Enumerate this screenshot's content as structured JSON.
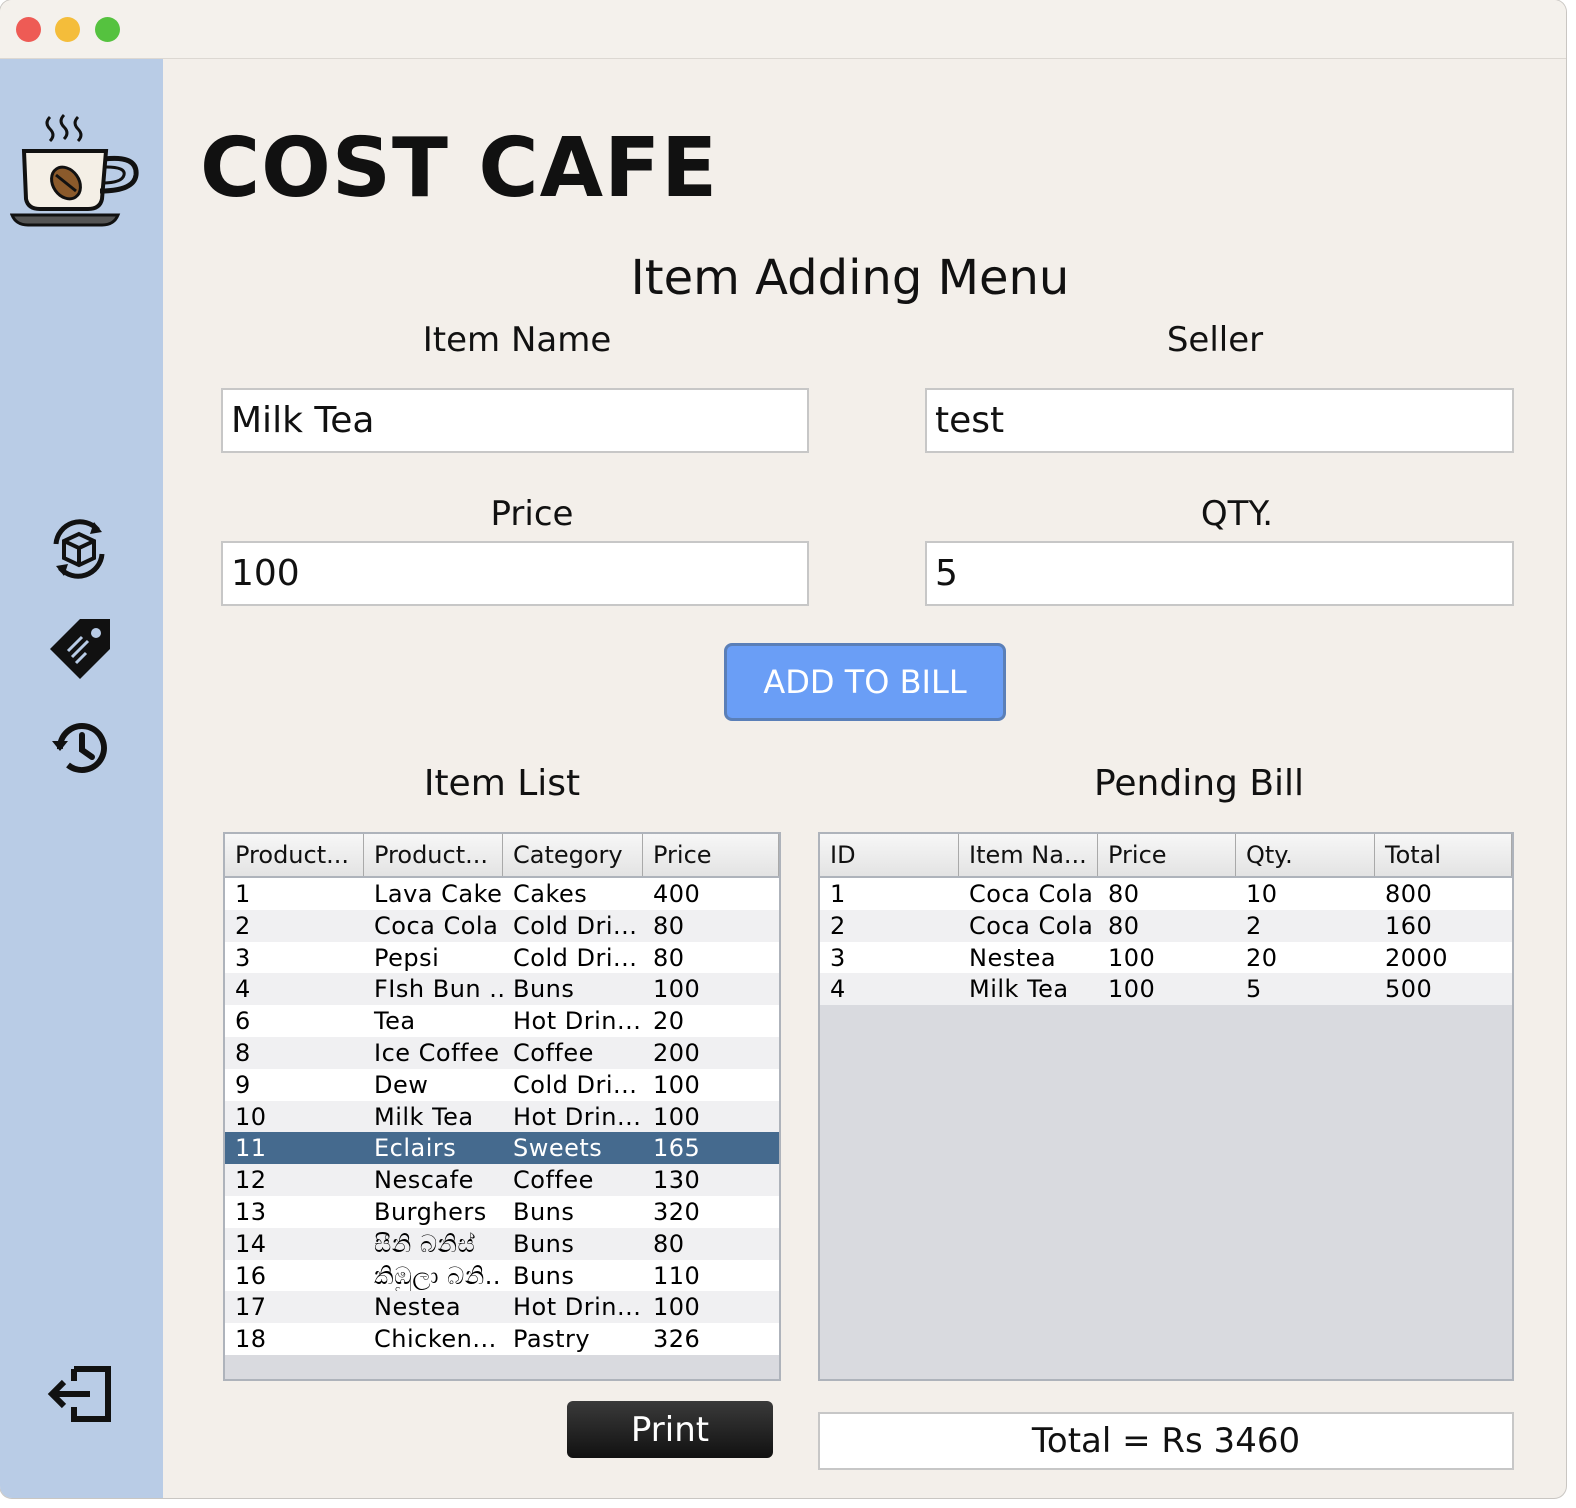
{
  "window": {
    "controls": {
      "close_color": "#ee5b55",
      "minimize_color": "#f4bd3a",
      "maximize_color": "#55c23f"
    }
  },
  "sidebar": {
    "items": [
      {
        "icon": "coffee-cup-logo-icon"
      },
      {
        "icon": "package-refresh-icon"
      },
      {
        "icon": "price-tag-icon"
      },
      {
        "icon": "history-icon"
      },
      {
        "icon": "logout-icon"
      }
    ]
  },
  "brand": {
    "title": "COST CAFE"
  },
  "form": {
    "heading": "Item Adding Menu",
    "item_name_label": "Item Name",
    "item_name_value": "Milk Tea",
    "seller_label": "Seller",
    "seller_value": "test",
    "price_label": "Price",
    "price_value": "100",
    "qty_label": "QTY.",
    "qty_value": "5",
    "add_button": "ADD TO BILL"
  },
  "item_list": {
    "heading": "Item List",
    "columns": [
      "Product...",
      "Product...",
      "Category",
      "Price"
    ],
    "selected_index": 8,
    "rows": [
      [
        "1",
        "Lava Cake",
        "Cakes",
        "400"
      ],
      [
        "2",
        "Coca Cola",
        "Cold Dri...",
        "80"
      ],
      [
        "3",
        "Pepsi",
        "Cold Dri...",
        "80"
      ],
      [
        "4",
        "FIsh Bun ...",
        "Buns",
        "100"
      ],
      [
        "6",
        "Tea",
        "Hot Drin...",
        "20"
      ],
      [
        "8",
        "Ice Coffee",
        "Coffee",
        "200"
      ],
      [
        "9",
        "Dew",
        "Cold Dri...",
        "100"
      ],
      [
        "10",
        "Milk Tea",
        "Hot Drin...",
        "100"
      ],
      [
        "11",
        "Eclairs",
        "Sweets",
        "165"
      ],
      [
        "12",
        "Nescafe",
        "Coffee",
        "130"
      ],
      [
        "13",
        "Burghers",
        "Buns",
        "320"
      ],
      [
        "14",
        "සීනි බනිස්",
        "Buns",
        "80"
      ],
      [
        "16",
        "කිඹුලා බනි...",
        "Buns",
        "110"
      ],
      [
        "17",
        "Nestea",
        "Hot Drin...",
        "100"
      ],
      [
        "18",
        "Chicken...",
        "Pastry",
        "326"
      ]
    ]
  },
  "pending_bill": {
    "heading": "Pending Bill",
    "columns": [
      "ID",
      "Item Na...",
      "Price",
      "Qty.",
      "Total"
    ],
    "rows": [
      [
        "1",
        "Coca Cola",
        "80",
        "10",
        "800"
      ],
      [
        "2",
        "Coca Cola",
        "80",
        "2",
        "160"
      ],
      [
        "3",
        "Nestea",
        "100",
        "20",
        "2000"
      ],
      [
        "4",
        "Milk Tea",
        "100",
        "5",
        "500"
      ]
    ],
    "total_text": "Total = Rs 3460"
  },
  "print_button": "Print"
}
